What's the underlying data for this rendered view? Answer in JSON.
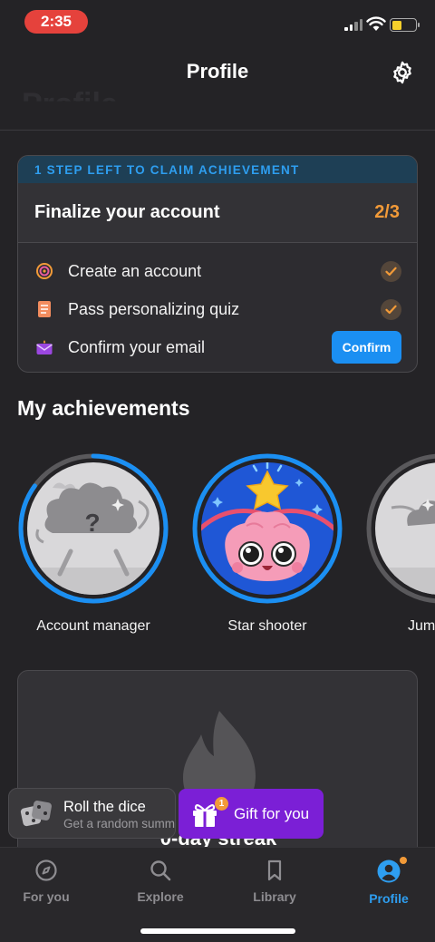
{
  "status_bar": {
    "time": "2:35",
    "battery_level": 0.4
  },
  "header": {
    "title": "Profile",
    "ghost_title": "Profile"
  },
  "claim_card": {
    "banner": "1 STEP LEFT TO CLAIM ACHIEVEMENT",
    "title": "Finalize your account",
    "progress": "2/3",
    "tasks": [
      {
        "label": "Create an account",
        "icon": "target-icon",
        "done": true
      },
      {
        "label": "Pass personalizing quiz",
        "icon": "notebook-icon",
        "done": true
      },
      {
        "label": "Confirm your email",
        "icon": "mail-icon",
        "done": false,
        "action": "Confirm"
      }
    ]
  },
  "achievements": {
    "title": "My achievements",
    "items": [
      {
        "label": "Account manager",
        "icon": "locked-brain-icon",
        "progress": 0.85
      },
      {
        "label": "Star shooter",
        "icon": "star-brain-icon",
        "progress": 1.0
      },
      {
        "label": "Jum",
        "icon": "locked-brain-icon",
        "progress": 0.5
      }
    ]
  },
  "streak": {
    "label": "0-day streak"
  },
  "promos": {
    "dice": {
      "title": "Roll the dice",
      "subtitle": "Get a random summ"
    },
    "gift": {
      "label": "Gift for you",
      "badge": "1"
    }
  },
  "tabs": [
    {
      "label": "For you",
      "icon": "compass-icon",
      "active": false
    },
    {
      "label": "Explore",
      "icon": "search-icon",
      "active": false
    },
    {
      "label": "Library",
      "icon": "bookmark-icon",
      "active": false
    },
    {
      "label": "Profile",
      "icon": "user-icon",
      "active": true
    }
  ],
  "colors": {
    "accent": "#2e9ef0",
    "orange": "#f29a38",
    "gift": "#7b1fd6",
    "background": "#242326"
  }
}
